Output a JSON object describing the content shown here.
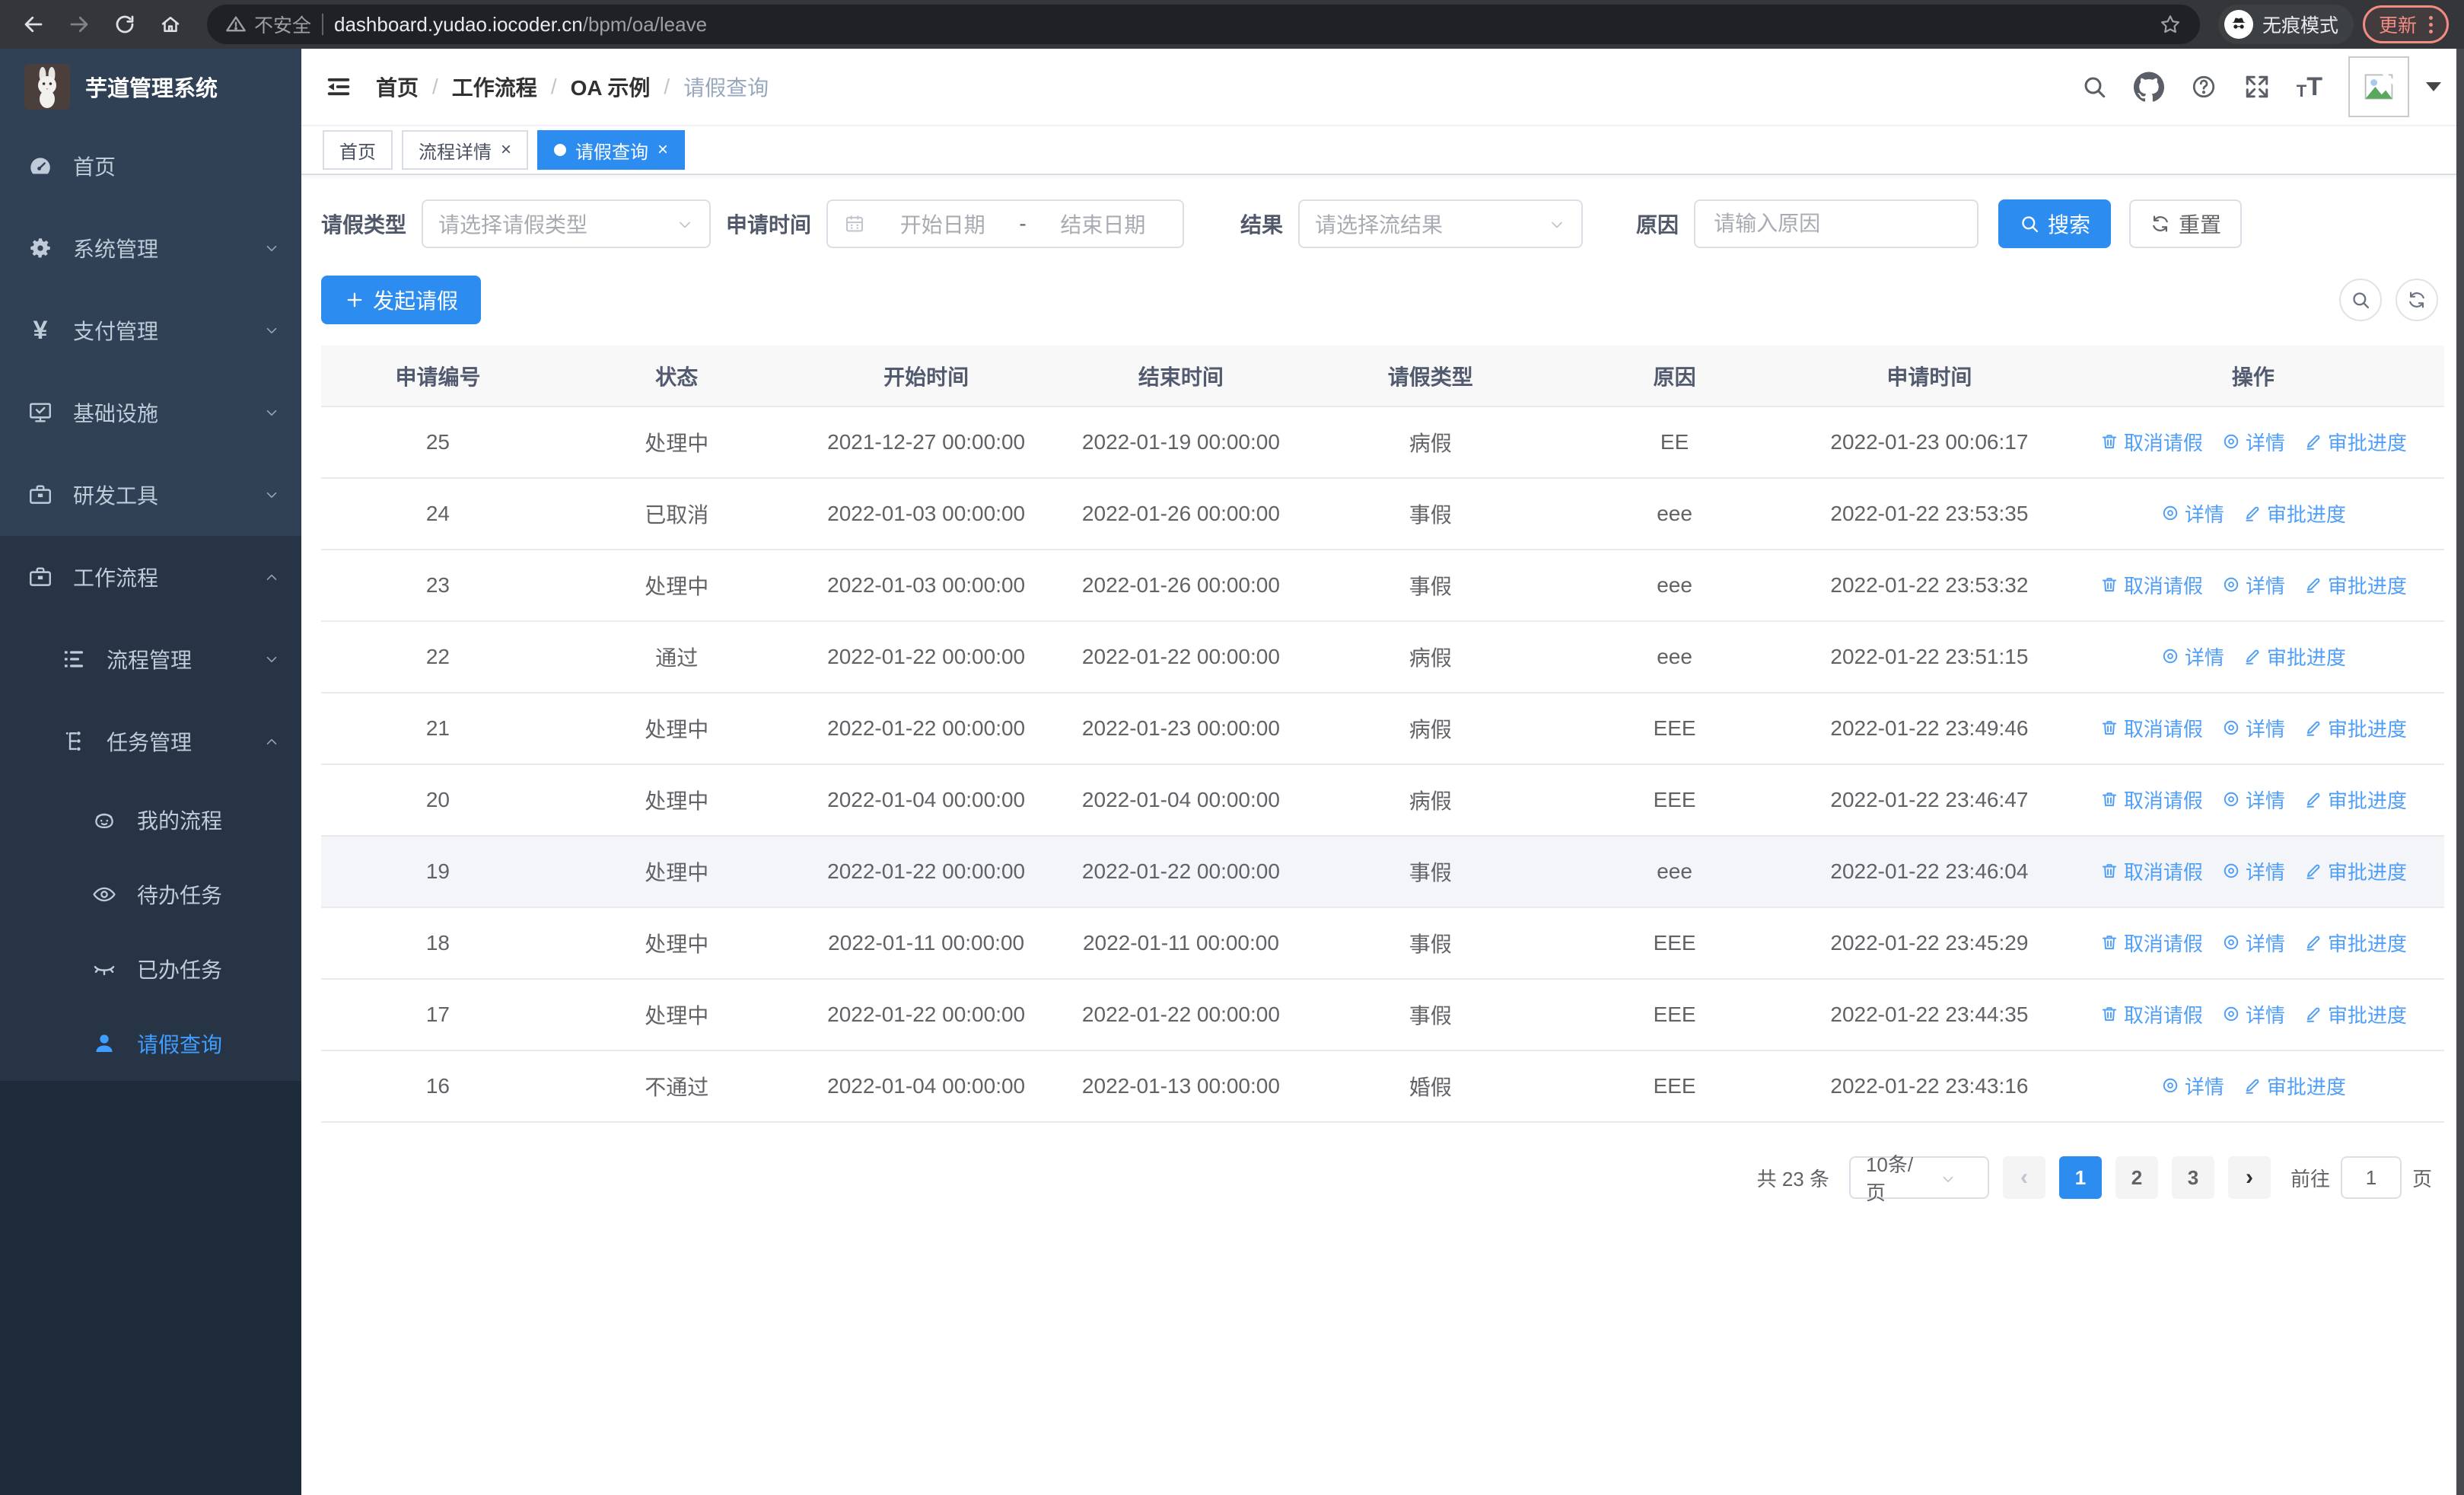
{
  "browser": {
    "security_label": "不安全",
    "url_host": "dashboard.yudao.iocoder.cn",
    "url_path": "/bpm/oa/leave",
    "incognito_label": "无痕模式",
    "update_label": "更新"
  },
  "sidebar": {
    "app_title": "芋道管理系统",
    "menu": [
      {
        "label": "首页",
        "icon": "dashboard-icon",
        "level": 1
      },
      {
        "label": "系统管理",
        "icon": "gear-icon",
        "level": 1,
        "chevron": "down"
      },
      {
        "label": "支付管理",
        "icon": "yen-icon",
        "level": 1,
        "chevron": "down"
      },
      {
        "label": "基础设施",
        "icon": "monitor-icon",
        "level": 1,
        "chevron": "down"
      },
      {
        "label": "研发工具",
        "icon": "toolbox-icon",
        "level": 1,
        "chevron": "down"
      },
      {
        "label": "工作流程",
        "icon": "briefcase-icon",
        "level": 1,
        "chevron": "up",
        "open": true
      },
      {
        "label": "流程管理",
        "icon": "list-icon",
        "level": 2,
        "chevron": "down"
      },
      {
        "label": "任务管理",
        "icon": "tree-icon",
        "level": 2,
        "chevron": "up",
        "open": true
      },
      {
        "label": "我的流程",
        "icon": "robot-icon",
        "level": 3
      },
      {
        "label": "待办任务",
        "icon": "eye-icon",
        "level": 3
      },
      {
        "label": "已办任务",
        "icon": "eye-closed-icon",
        "level": 3
      },
      {
        "label": "请假查询",
        "icon": "user-icon",
        "level": 3,
        "active": true
      }
    ]
  },
  "header": {
    "breadcrumb": [
      "首页",
      "工作流程",
      "OA 示例",
      "请假查询"
    ]
  },
  "tabs": [
    {
      "label": "首页",
      "closable": false,
      "active": false
    },
    {
      "label": "流程详情",
      "closable": true,
      "active": false
    },
    {
      "label": "请假查询",
      "closable": true,
      "active": true
    }
  ],
  "filters": {
    "leave_type_label": "请假类型",
    "leave_type_placeholder": "请选择请假类型",
    "apply_time_label": "申请时间",
    "date_start_placeholder": "开始日期",
    "date_separator": "-",
    "date_end_placeholder": "结束日期",
    "result_label": "结果",
    "result_placeholder": "请选择流结果",
    "reason_label": "原因",
    "reason_placeholder": "请输入原因",
    "search_label": "搜索",
    "reset_label": "重置"
  },
  "toolbar": {
    "create_label": "发起请假"
  },
  "table": {
    "columns": [
      "申请编号",
      "状态",
      "开始时间",
      "结束时间",
      "请假类型",
      "原因",
      "申请时间",
      "操作"
    ],
    "actions": {
      "cancel": "取消请假",
      "detail": "详情",
      "progress": "审批进度"
    },
    "rows": [
      {
        "id": "25",
        "status": "处理中",
        "start": "2021-12-27 00:00:00",
        "end": "2022-01-19 00:00:00",
        "type": "病假",
        "reason": "EE",
        "applied": "2022-01-23 00:06:17",
        "cancellable": true,
        "highlight": false
      },
      {
        "id": "24",
        "status": "已取消",
        "start": "2022-01-03 00:00:00",
        "end": "2022-01-26 00:00:00",
        "type": "事假",
        "reason": "eee",
        "applied": "2022-01-22 23:53:35",
        "cancellable": false,
        "highlight": false
      },
      {
        "id": "23",
        "status": "处理中",
        "start": "2022-01-03 00:00:00",
        "end": "2022-01-26 00:00:00",
        "type": "事假",
        "reason": "eee",
        "applied": "2022-01-22 23:53:32",
        "cancellable": true,
        "highlight": false
      },
      {
        "id": "22",
        "status": "通过",
        "start": "2022-01-22 00:00:00",
        "end": "2022-01-22 00:00:00",
        "type": "病假",
        "reason": "eee",
        "applied": "2022-01-22 23:51:15",
        "cancellable": false,
        "highlight": false
      },
      {
        "id": "21",
        "status": "处理中",
        "start": "2022-01-22 00:00:00",
        "end": "2022-01-23 00:00:00",
        "type": "病假",
        "reason": "EEE",
        "applied": "2022-01-22 23:49:46",
        "cancellable": true,
        "highlight": false
      },
      {
        "id": "20",
        "status": "处理中",
        "start": "2022-01-04 00:00:00",
        "end": "2022-01-04 00:00:00",
        "type": "病假",
        "reason": "EEE",
        "applied": "2022-01-22 23:46:47",
        "cancellable": true,
        "highlight": false
      },
      {
        "id": "19",
        "status": "处理中",
        "start": "2022-01-22 00:00:00",
        "end": "2022-01-22 00:00:00",
        "type": "事假",
        "reason": "eee",
        "applied": "2022-01-22 23:46:04",
        "cancellable": true,
        "highlight": true
      },
      {
        "id": "18",
        "status": "处理中",
        "start": "2022-01-11 00:00:00",
        "end": "2022-01-11 00:00:00",
        "type": "事假",
        "reason": "EEE",
        "applied": "2022-01-22 23:45:29",
        "cancellable": true,
        "highlight": false
      },
      {
        "id": "17",
        "status": "处理中",
        "start": "2022-01-22 00:00:00",
        "end": "2022-01-22 00:00:00",
        "type": "事假",
        "reason": "EEE",
        "applied": "2022-01-22 23:44:35",
        "cancellable": true,
        "highlight": false
      },
      {
        "id": "16",
        "status": "不通过",
        "start": "2022-01-04 00:00:00",
        "end": "2022-01-13 00:00:00",
        "type": "婚假",
        "reason": "EEE",
        "applied": "2022-01-22 23:43:16",
        "cancellable": false,
        "highlight": false
      }
    ]
  },
  "pagination": {
    "total": "共 23 条",
    "page_size": "10条/页",
    "pages": [
      "1",
      "2",
      "3"
    ],
    "active_page": "1",
    "prev_glyph": "‹",
    "next_glyph": "›",
    "goto_label": "前往",
    "goto_value": "1",
    "unit_label": "页"
  },
  "colors": {
    "primary": "#2d8cf0",
    "link": "#4f9ef7",
    "sidebar": "#304156",
    "sidebar_sub": "#263445",
    "active_menu": "#409eff"
  }
}
